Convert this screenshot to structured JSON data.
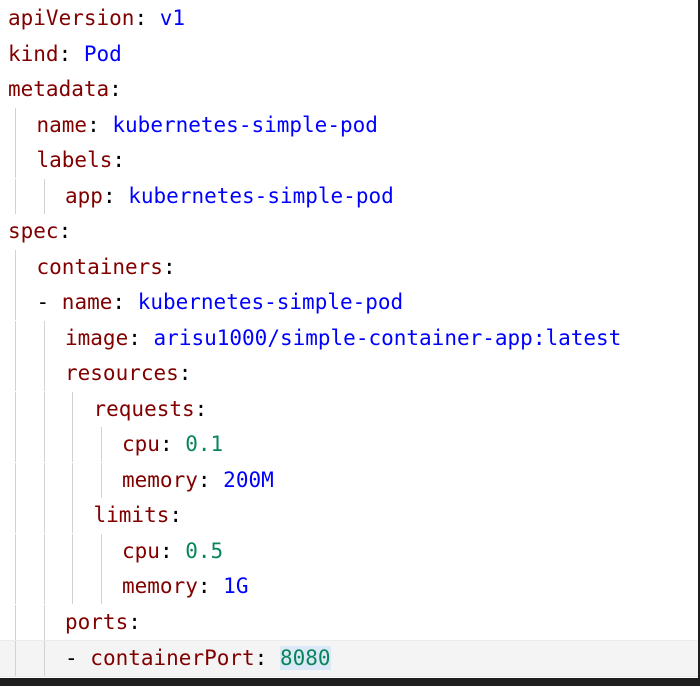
{
  "editor": {
    "language": "yaml",
    "colors": {
      "key": "#800000",
      "string": "#0000ff",
      "number": "#098658",
      "punctuation": "#000000"
    },
    "lines": [
      {
        "indent": 0,
        "dash": false,
        "key": "apiVersion",
        "value": "v1",
        "value_type": "string"
      },
      {
        "indent": 0,
        "dash": false,
        "key": "kind",
        "value": "Pod",
        "value_type": "string"
      },
      {
        "indent": 0,
        "dash": false,
        "key": "metadata",
        "value": "",
        "value_type": "none"
      },
      {
        "indent": 1,
        "dash": false,
        "key": "name",
        "value": "kubernetes-simple-pod",
        "value_type": "string"
      },
      {
        "indent": 1,
        "dash": false,
        "key": "labels",
        "value": "",
        "value_type": "none"
      },
      {
        "indent": 2,
        "dash": false,
        "key": "app",
        "value": "kubernetes-simple-pod",
        "value_type": "string"
      },
      {
        "indent": 0,
        "dash": false,
        "key": "spec",
        "value": "",
        "value_type": "none"
      },
      {
        "indent": 1,
        "dash": false,
        "key": "containers",
        "value": "",
        "value_type": "none"
      },
      {
        "indent": 1,
        "dash": true,
        "key": "name",
        "value": "kubernetes-simple-pod",
        "value_type": "string"
      },
      {
        "indent": 2,
        "dash": false,
        "key": "image",
        "value": "arisu1000/simple-container-app:latest",
        "value_type": "string"
      },
      {
        "indent": 2,
        "dash": false,
        "key": "resources",
        "value": "",
        "value_type": "none"
      },
      {
        "indent": 3,
        "dash": false,
        "key": "requests",
        "value": "",
        "value_type": "none"
      },
      {
        "indent": 4,
        "dash": false,
        "key": "cpu",
        "value": "0.1",
        "value_type": "number"
      },
      {
        "indent": 4,
        "dash": false,
        "key": "memory",
        "value": "200M",
        "value_type": "string"
      },
      {
        "indent": 3,
        "dash": false,
        "key": "limits",
        "value": "",
        "value_type": "none"
      },
      {
        "indent": 4,
        "dash": false,
        "key": "cpu",
        "value": "0.5",
        "value_type": "number"
      },
      {
        "indent": 4,
        "dash": false,
        "key": "memory",
        "value": "1G",
        "value_type": "string"
      },
      {
        "indent": 2,
        "dash": false,
        "key": "ports",
        "value": "",
        "value_type": "none"
      },
      {
        "indent": 2,
        "dash": true,
        "key": "containerPort",
        "value": "8080",
        "value_type": "number",
        "current": true,
        "selected": true
      }
    ]
  }
}
